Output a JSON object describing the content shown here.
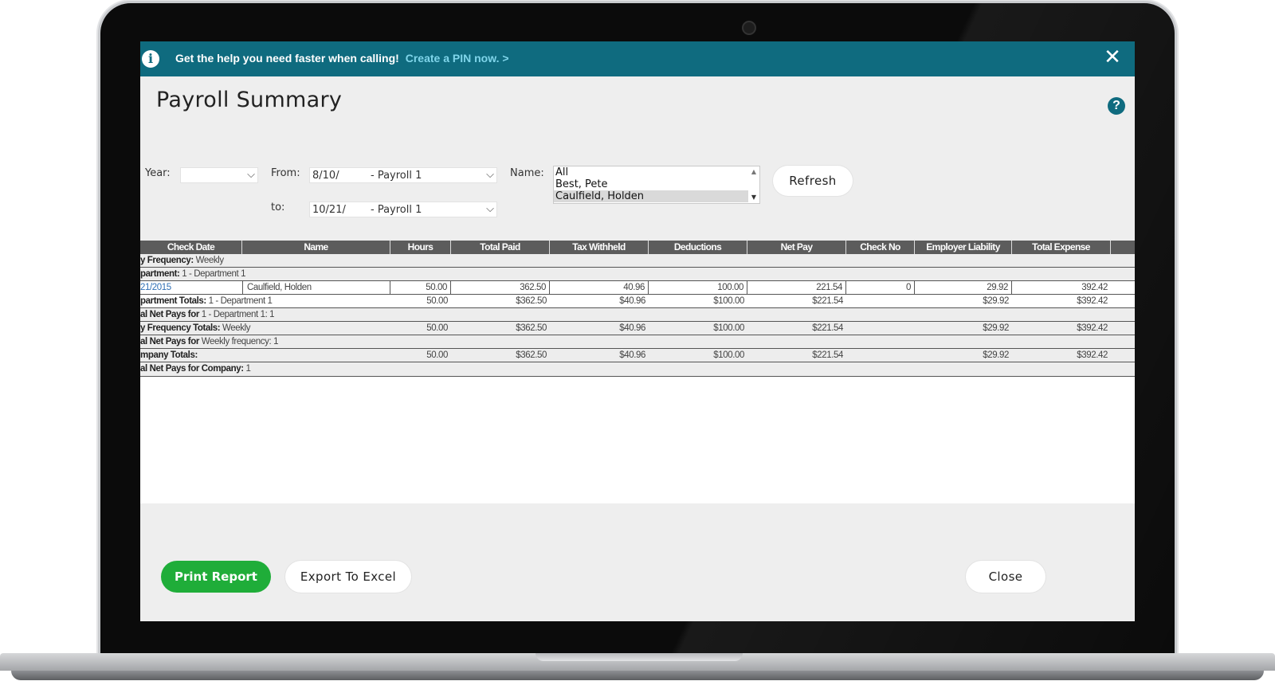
{
  "banner": {
    "text": "Get the help you need faster when calling!",
    "link_text": "Create a PIN now. >",
    "close_icon": "close-icon",
    "info_icon": "info-icon"
  },
  "page_title": "Payroll Summary",
  "filters": {
    "year_label": "Year:",
    "year_value": "",
    "from_label": "From:",
    "from_date": "8/10/",
    "from_payroll": "- Payroll 1",
    "to_label": "to:",
    "to_date": "10/21/",
    "to_payroll": "- Payroll 1",
    "name_label": "Name:",
    "name_options": [
      "All",
      "Best, Pete",
      "Caulfield, Holden"
    ],
    "name_selected": "Caulfield, Holden",
    "refresh_label": "Refresh"
  },
  "report": {
    "columns": [
      "Check Date",
      "Name",
      "Hours",
      "Total Paid",
      "Tax Withheld",
      "Deductions",
      "Net Pay",
      "Check No",
      "Employer Liability",
      "Total Expense"
    ],
    "pay_frequency": {
      "label": "y Frequency:",
      "value": "Weekly"
    },
    "department": {
      "label": "partment:",
      "value": "1 - Department 1"
    },
    "detail_row": {
      "check_date": "21/2015",
      "name": "Caulfield, Holden",
      "hours": "50.00",
      "total_paid": "362.50",
      "tax_withheld": "40.96",
      "deductions": "100.00",
      "net_pay": "221.54",
      "check_no": "0",
      "employer_liability": "29.92",
      "total_expense": "392.42"
    },
    "department_totals": {
      "label": "partment Totals:",
      "value": "1 - Department 1",
      "hours": "50.00",
      "total_paid": "$362.50",
      "tax_withheld": "$40.96",
      "deductions": "$100.00",
      "net_pay": "$221.54",
      "employer_liability": "$29.92",
      "total_expense": "$392.42"
    },
    "net_pays_department": {
      "label": "al Net Pays for",
      "value": "1 - Department 1: 1"
    },
    "frequency_totals": {
      "label": "y Frequency Totals:",
      "value": "Weekly",
      "hours": "50.00",
      "total_paid": "$362.50",
      "tax_withheld": "$40.96",
      "deductions": "$100.00",
      "net_pay": "$221.54",
      "employer_liability": "$29.92",
      "total_expense": "$392.42"
    },
    "net_pays_frequency": {
      "label": "al Net Pays for",
      "value": "Weekly frequency: 1"
    },
    "company_totals": {
      "label": "mpany Totals:",
      "hours": "50.00",
      "total_paid": "$362.50",
      "tax_withheld": "$40.96",
      "deductions": "$100.00",
      "net_pay": "$221.54",
      "employer_liability": "$29.92",
      "total_expense": "$392.42"
    },
    "net_pays_company": {
      "label": "al Net Pays for Company:",
      "value": "1"
    }
  },
  "footer": {
    "print_label": "Print Report",
    "export_label": "Export To Excel",
    "close_label": "Close"
  },
  "colors": {
    "banner": "#0f6b7f",
    "link": "#7fd5ea",
    "primary_button": "#1fad39",
    "table_header": "#5c5c5c"
  }
}
